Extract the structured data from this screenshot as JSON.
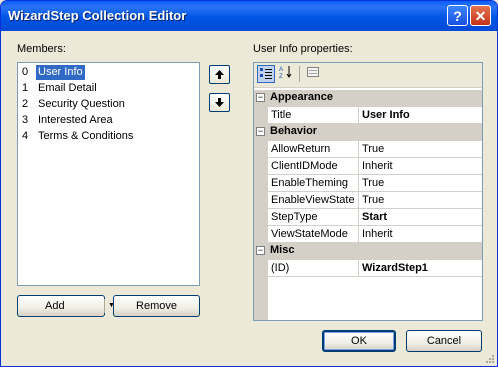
{
  "window": {
    "title": "WizardStep Collection Editor",
    "help_label": "?",
    "close_label": "✕"
  },
  "members": {
    "label": "Members:",
    "items": [
      {
        "index": "0",
        "label": "User Info",
        "selected": true
      },
      {
        "index": "1",
        "label": "Email Detail"
      },
      {
        "index": "2",
        "label": "Security Question"
      },
      {
        "index": "3",
        "label": "Interested Area"
      },
      {
        "index": "4",
        "label": "Terms & Conditions"
      }
    ],
    "move_up_label": "🡅",
    "move_down_label": "🡇"
  },
  "buttons": {
    "add_label": "Add",
    "add_arrow": "▼",
    "remove_label": "Remove",
    "ok_label": "OK",
    "cancel_label": "Cancel"
  },
  "properties": {
    "label": "User Info properties:",
    "categories": [
      {
        "name": "Appearance",
        "props": [
          {
            "name": "Title",
            "value": "User Info",
            "bold": true
          }
        ]
      },
      {
        "name": "Behavior",
        "props": [
          {
            "name": "AllowReturn",
            "value": "True"
          },
          {
            "name": "ClientIDMode",
            "value": "Inherit"
          },
          {
            "name": "EnableTheming",
            "value": "True"
          },
          {
            "name": "EnableViewState",
            "value": "True"
          },
          {
            "name": "StepType",
            "value": "Start",
            "bold": true
          },
          {
            "name": "ViewStateMode",
            "value": "Inherit"
          }
        ]
      },
      {
        "name": "Misc",
        "props": [
          {
            "name": "(ID)",
            "value": "WizardStep1",
            "bold": true
          }
        ]
      }
    ],
    "collapse_glyph": "−"
  }
}
